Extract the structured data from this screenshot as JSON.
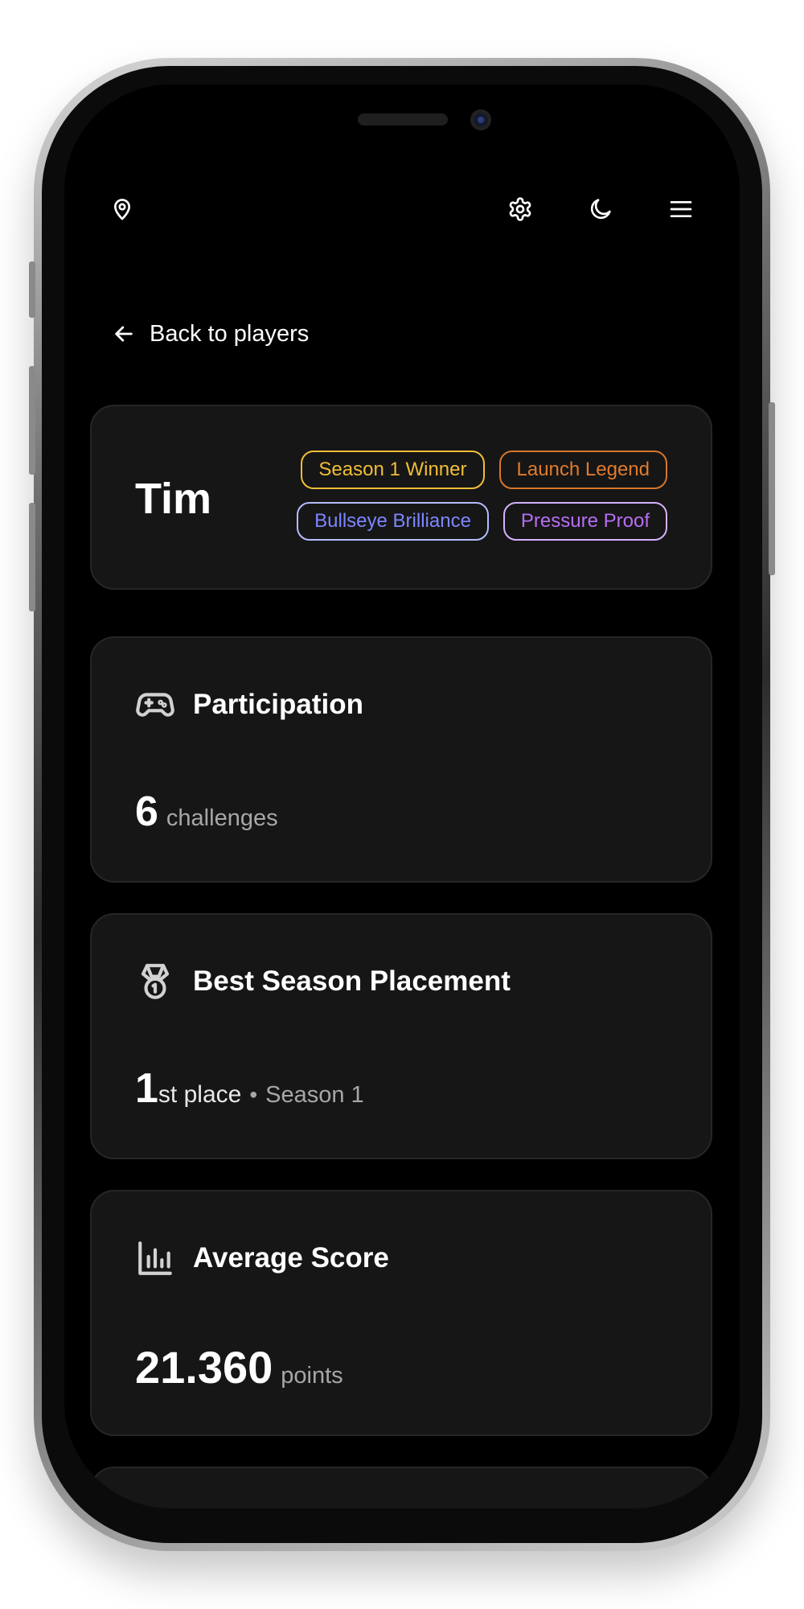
{
  "header": {
    "location_icon": "map-pin-icon",
    "settings_icon": "gear-icon",
    "theme_icon": "moon-icon",
    "menu_icon": "hamburger-menu-icon"
  },
  "back_link": {
    "label": "Back to players",
    "icon": "arrow-left-icon"
  },
  "player": {
    "name": "Tim",
    "badges": [
      {
        "label": "Season 1 Winner",
        "color": "#f2be36"
      },
      {
        "label": "Launch Legend",
        "color": "#e07b2c"
      },
      {
        "label": "Bullseye Brilliance",
        "color": "#7d86ff"
      },
      {
        "label": "Pressure Proof",
        "color": "#b66ef4"
      }
    ]
  },
  "stats": {
    "participation": {
      "title": "Participation",
      "icon": "gamepad-icon",
      "value": "6",
      "unit": "challenges"
    },
    "best_placement": {
      "title": "Best Season Placement",
      "icon": "medal-icon",
      "value": "1",
      "suffix": "st place",
      "separator": "•",
      "season": "Season 1"
    },
    "average_score": {
      "title": "Average Score",
      "icon": "bar-chart-icon",
      "value": "21.360",
      "unit": "points"
    }
  }
}
